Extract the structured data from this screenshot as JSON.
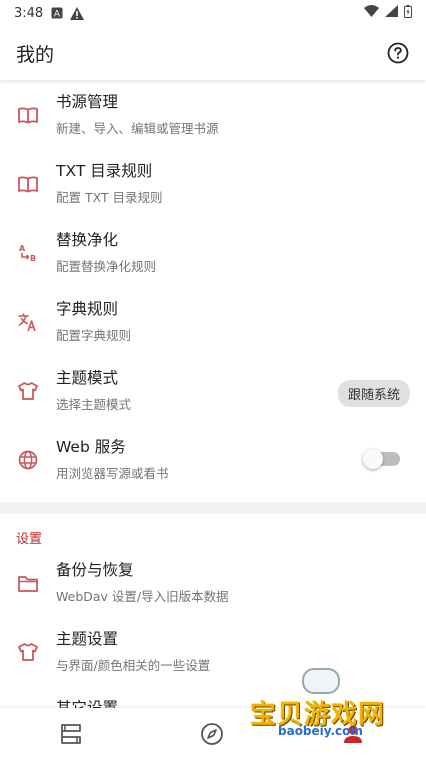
{
  "status_bar": {
    "time": "3:48",
    "icons": [
      "a-icon",
      "warning-icon"
    ],
    "right_icons": [
      "wifi-icon",
      "signal-icon",
      "battery-icon"
    ]
  },
  "app_bar": {
    "title": "我的",
    "help_icon": "help-circle-icon"
  },
  "items": [
    {
      "icon": "book-icon",
      "title": "书源管理",
      "subtitle": "新建、导入、编辑或管理书源"
    },
    {
      "icon": "book-icon",
      "title": "TXT 目录规则",
      "subtitle": "配置 TXT 目录规则"
    },
    {
      "icon": "replace-icon",
      "title": "替换净化",
      "subtitle": "配置替换净化规则"
    },
    {
      "icon": "translate-icon",
      "title": "字典规则",
      "subtitle": "配置字典规则"
    },
    {
      "icon": "tshirt-icon",
      "title": "主题模式",
      "subtitle": "选择主题模式",
      "chip": "跟随系统"
    },
    {
      "icon": "globe-icon",
      "title": "Web 服务",
      "subtitle": "用浏览器写源或看书",
      "switch_on": false
    }
  ],
  "settings_section": {
    "header": "设置",
    "items": [
      {
        "icon": "folder-icon",
        "title": "备份与恢复",
        "subtitle": "WebDav 设置/导入旧版本数据"
      },
      {
        "icon": "tshirt-icon",
        "title": "主题设置",
        "subtitle": "与界面/颜色相关的一些设置"
      },
      {
        "icon": "settings-icon",
        "title": "其它设置",
        "subtitle": ""
      }
    ]
  },
  "bottom_nav": [
    "bookshelf-icon",
    "compass-icon",
    "person-icon"
  ],
  "watermark": {
    "text": "宝贝游戏网",
    "url": "baobeiy.com"
  },
  "colors": {
    "accent": "#c62828",
    "icon": "#c9575c"
  }
}
